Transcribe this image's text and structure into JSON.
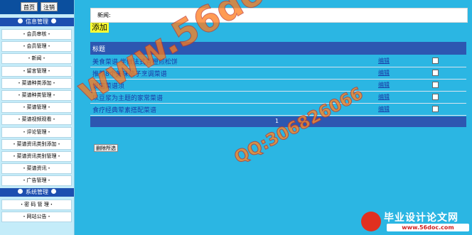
{
  "sidebar": {
    "top_buttons": {
      "home": "首页",
      "logout": "注销"
    },
    "sections": [
      {
        "title": "信息管理",
        "items": [
          "・会员审核・",
          "・会员管理・",
          "・新闻・",
          "・留言管理・",
          "・菜谱种类添加・",
          "・菜谱种类管理・",
          "・菜谱管理・",
          "・菜谱视频观看・",
          "・评论管理・",
          "・菜谱资讯类别添加・",
          "・菜谱资讯类别管理・",
          "・菜谱资讯・",
          "・广告管理・"
        ]
      },
      {
        "title": "系统管理",
        "items": [
          "・密 码 管 理・",
          "・网站公告・"
        ]
      }
    ]
  },
  "main": {
    "news_label": "新闻:",
    "news_value": "",
    "add_button": "添加",
    "table": {
      "header": "标题",
      "rows": [
        {
          "title": "美食菜谱 学做法式香橙煎松饼",
          "action": "编辑"
        },
        {
          "title": "推荐8个美味茄子烹调菜谱",
          "action": "编辑"
        },
        {
          "title": "饭店菜谱须",
          "action": "编辑"
        },
        {
          "title": "以豆浆为主题的家常菜谱",
          "action": "编辑"
        },
        {
          "title": "食疗经典荤素搭配菜谱",
          "action": "编辑"
        }
      ],
      "pager": "1"
    },
    "batch_delete": "删除所选"
  },
  "watermarks": {
    "site": "www.56doc.com",
    "qq": "QQ:306826066",
    "logo_title": "毕业设计论文网",
    "logo_url": "www.56doc.com"
  }
}
